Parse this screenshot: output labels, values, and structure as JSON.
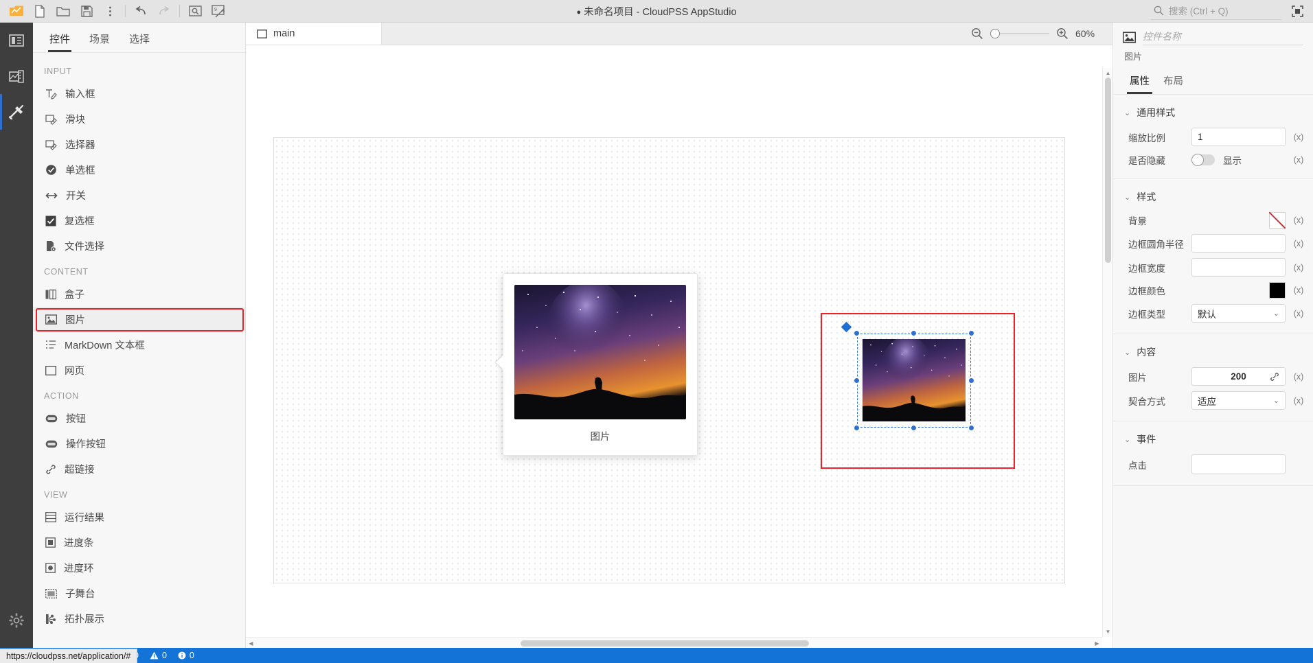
{
  "titlebar": {
    "project_title": "未命名项目 - CloudPSS AppStudio",
    "modified_dot": "●",
    "tools": [
      {
        "name": "app-logo-icon",
        "label": "CloudPSS"
      },
      {
        "name": "new-file-icon",
        "label": "新建"
      },
      {
        "name": "open-folder-icon",
        "label": "打开"
      },
      {
        "name": "save-icon",
        "label": "保存"
      },
      {
        "name": "more-options-icon",
        "label": "更多"
      },
      {
        "name": "undo-icon",
        "label": "撤销"
      },
      {
        "name": "redo-icon",
        "label": "重做"
      },
      {
        "name": "preview-icon",
        "label": "预览"
      },
      {
        "name": "publish-icon",
        "label": "发布"
      }
    ],
    "search_placeholder": "搜索 (Ctrl + Q)",
    "window_button": "最大化"
  },
  "rail": {
    "items": [
      {
        "name": "rail-explorer",
        "label": "资源管理器"
      },
      {
        "name": "rail-resources",
        "label": "素材"
      },
      {
        "name": "rail-widgets",
        "label": "控件"
      }
    ],
    "settings_label": "设置"
  },
  "panel": {
    "tabs": [
      {
        "label": "控件",
        "active": true
      },
      {
        "label": "场景",
        "active": false
      },
      {
        "label": "选择",
        "active": false
      }
    ],
    "groups": [
      {
        "title": "INPUT",
        "items": [
          {
            "label": "输入框",
            "icon": "text-input-icon"
          },
          {
            "label": "滑块",
            "icon": "slider-input-icon"
          },
          {
            "label": "选择器",
            "icon": "selector-input-icon"
          },
          {
            "label": "单选框",
            "icon": "radio-icon"
          },
          {
            "label": "开关",
            "icon": "switch-icon"
          },
          {
            "label": "复选框",
            "icon": "checkbox-icon"
          },
          {
            "label": "文件选择",
            "icon": "file-picker-icon"
          }
        ]
      },
      {
        "title": "CONTENT",
        "items": [
          {
            "label": "盒子",
            "icon": "box-icon"
          },
          {
            "label": "图片",
            "icon": "image-icon",
            "highlighted": true
          },
          {
            "label": "MarkDown 文本框",
            "icon": "markdown-icon"
          },
          {
            "label": "网页",
            "icon": "webpage-icon"
          }
        ]
      },
      {
        "title": "ACTION",
        "items": [
          {
            "label": "按钮",
            "icon": "button-icon"
          },
          {
            "label": "操作按钮",
            "icon": "action-button-icon"
          },
          {
            "label": "超链接",
            "icon": "link-icon"
          }
        ]
      },
      {
        "title": "VIEW",
        "items": [
          {
            "label": "运行结果",
            "icon": "result-icon"
          },
          {
            "label": "进度条",
            "icon": "progress-bar-icon"
          },
          {
            "label": "进度环",
            "icon": "progress-ring-icon"
          },
          {
            "label": "子舞台",
            "icon": "sub-stage-icon"
          },
          {
            "label": "拓扑展示",
            "icon": "topology-icon"
          }
        ]
      }
    ]
  },
  "canvas": {
    "scene_tab": "main",
    "zoom_percent": "60%",
    "zoom_out_label": "缩小",
    "zoom_in_label": "放大",
    "drag_ghost_caption": "图片"
  },
  "props": {
    "widget_icon": "image-icon",
    "name_placeholder": "控件名称",
    "name_value": "",
    "widget_type": "图片",
    "tabs": [
      {
        "label": "属性",
        "active": true
      },
      {
        "label": "布局",
        "active": false
      }
    ],
    "sections": [
      {
        "title": "通用样式",
        "rows": [
          {
            "label": "缩放比例",
            "type": "text",
            "value": "1",
            "fx": "(x)"
          },
          {
            "label": "是否隐藏",
            "type": "toggle",
            "value": "显示",
            "fx": "(x)"
          }
        ]
      },
      {
        "title": "样式",
        "rows": [
          {
            "label": "背景",
            "type": "swatch-none",
            "value": "",
            "fx": "(x)"
          },
          {
            "label": "边框圆角半径",
            "type": "text",
            "value": "",
            "fx": "(x)"
          },
          {
            "label": "边框宽度",
            "type": "text",
            "value": "",
            "fx": "(x)"
          },
          {
            "label": "边框颜色",
            "type": "swatch-color",
            "value": "#000000",
            "fx": "(x)"
          },
          {
            "label": "边框类型",
            "type": "select",
            "value": "默认",
            "fx": "(x)"
          }
        ]
      },
      {
        "title": "内容",
        "rows": [
          {
            "label": "图片",
            "type": "text-link",
            "value": "200",
            "fx": "(x)"
          },
          {
            "label": "契合方式",
            "type": "select",
            "value": "适应",
            "fx": "(x)"
          }
        ]
      },
      {
        "title": "事件",
        "rows": [
          {
            "label": "点击",
            "type": "text",
            "value": "",
            "fx": ""
          }
        ]
      }
    ]
  },
  "statusbar": {
    "url_tooltip": "https://cloudpss.net/application/#",
    "error_count": "0",
    "warning_count": "0",
    "info_count": "0"
  }
}
